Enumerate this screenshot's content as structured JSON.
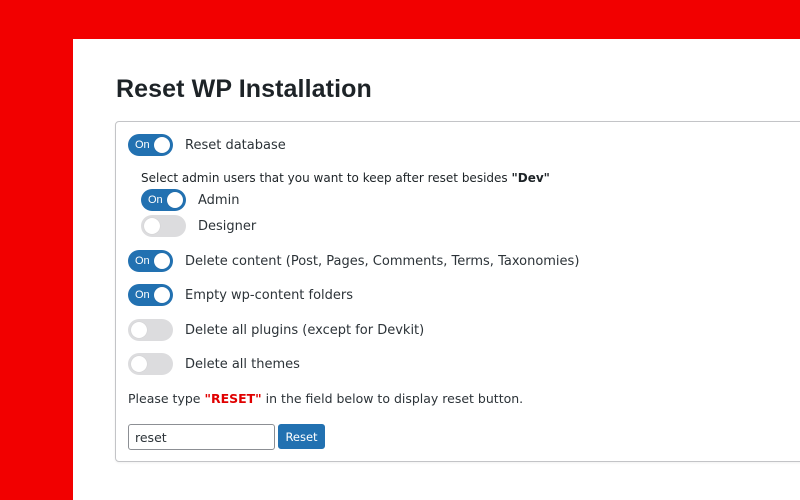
{
  "title": "Reset WP Installation",
  "options": {
    "reset_database": {
      "label": "Reset database",
      "state": "On",
      "enabled": true
    },
    "admins_note": {
      "prefix": "Select admin users that you want to keep after reset besides ",
      "user": "\"Dev\""
    },
    "admin_users": [
      {
        "label": "Admin",
        "state": "On",
        "enabled": true
      },
      {
        "label": "Designer",
        "state": "",
        "enabled": false
      }
    ],
    "delete_content": {
      "label": "Delete content (Post, Pages, Comments, Terms, Taxonomies)",
      "state": "On",
      "enabled": true
    },
    "empty_wp_content": {
      "label": "Empty wp-content folders",
      "state": "On",
      "enabled": true
    },
    "delete_plugins": {
      "label": "Delete all plugins (except for Devkit)",
      "state": "",
      "enabled": false
    },
    "delete_themes": {
      "label": "Delete all themes",
      "state": "",
      "enabled": false
    }
  },
  "hint": {
    "prefix": "Please type ",
    "keyword": "\"RESET\"",
    "suffix": " in the field below to display reset button."
  },
  "reset_field": {
    "value": "reset"
  },
  "reset_button": {
    "label": "Reset"
  },
  "colors": {
    "background": "#f20000",
    "toggle_on": "#2271b1",
    "toggle_off": "#dcdcde",
    "keyword": "#e00000"
  }
}
